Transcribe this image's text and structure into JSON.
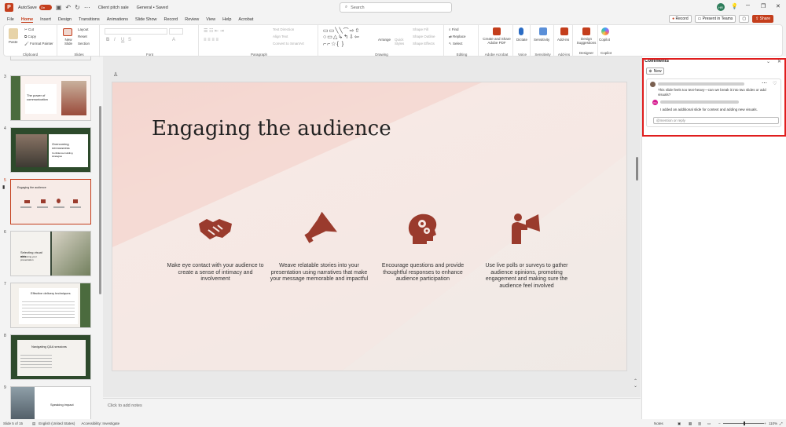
{
  "titlebar": {
    "app_logo": "P",
    "autosave_label": "AutoSave",
    "autosave_state": "On",
    "doc_name": "Client pitch sale",
    "sensitivity": "General • Saved",
    "search_placeholder": "Search",
    "user_initials": "HR"
  },
  "menu": {
    "tabs": [
      "File",
      "Home",
      "Insert",
      "Design",
      "Transitions",
      "Animations",
      "Slide Show",
      "Record",
      "Review",
      "View",
      "Help",
      "Acrobat"
    ],
    "active": "Home",
    "record_label": "Record",
    "present_label": "Present in Teams",
    "share_label": "Share"
  },
  "ribbon": {
    "clipboard": {
      "paste": "Paste",
      "cut": "Cut",
      "copy": "Copy",
      "format_painter": "Format Painter",
      "label": "Clipboard"
    },
    "slides": {
      "new_slide": "New Slide",
      "layout": "Layout",
      "reset": "Reset",
      "section": "Section",
      "label": "Slides"
    },
    "font": {
      "label": "Font"
    },
    "paragraph": {
      "text_direction": "Text Direction",
      "align_text": "Align Text",
      "convert_smartart": "Convert to SmartArt",
      "label": "Paragraph"
    },
    "drawing": {
      "arrange": "Arrange",
      "quick_styles": "Quick Styles",
      "shape_fill": "Shape Fill",
      "shape_outline": "Shape Outline",
      "shape_effects": "Shape Effects",
      "label": "Drawing"
    },
    "editing": {
      "find": "Find",
      "replace": "Replace",
      "select": "Select",
      "label": "Editing"
    },
    "acrobat": {
      "create_share": "Create and Share Adobe PDF",
      "label": "Adobe Acrobat"
    },
    "voice": {
      "dictate": "Dictate",
      "label": "Voice"
    },
    "sensitivity": {
      "btn": "Sensitivity",
      "label": "Sensitivity"
    },
    "addins": {
      "btn": "Add-ins",
      "label": "Add-ins"
    },
    "designer": {
      "btn": "Design Suggestions",
      "label": "Designer"
    },
    "copilot": {
      "btn": "Copilot",
      "label": "Copilot"
    }
  },
  "thumbnails": [
    {
      "num": "",
      "title": "",
      "bg": "#f2f2f2"
    },
    {
      "num": "3",
      "title": "The power of communication",
      "bg": "#fbf3f0"
    },
    {
      "num": "4",
      "title": "Overcoming nervousness",
      "sub": "Confidence-building strategies",
      "bg": "#2d4a2b"
    },
    {
      "num": "5",
      "title": "Engaging the audience",
      "bg": "#f7ebe7"
    },
    {
      "num": "6",
      "title": "Selecting visual aids",
      "sub": "Enhancing your presentation",
      "bg": "#3b4a3a"
    },
    {
      "num": "7",
      "title": "Effective delivery techniques",
      "bg": "#f4f1ec"
    },
    {
      "num": "8",
      "title": "Navigating Q&A sessions",
      "bg": "#2e4a2c"
    },
    {
      "num": "9",
      "title": "Speaking impact",
      "bg": "#ffffff"
    }
  ],
  "slide": {
    "title": "Engaging the audience",
    "features": [
      {
        "icon": "handshake-icon",
        "text": "Make eye contact with your audience to create a sense of intimacy and involvement"
      },
      {
        "icon": "megaphone-icon",
        "text": "Weave relatable stories into your presentation using narratives that make your message memorable and impactful"
      },
      {
        "icon": "head-gears-icon",
        "text": "Encourage questions and provide thoughtful responses to enhance audience participation"
      },
      {
        "icon": "person-megaphone-icon",
        "text": "Use live polls or surveys to gather audience opinions, promoting engagement and making sure the audience feel involved"
      }
    ],
    "accent_color": "#9a3b2d"
  },
  "notes": {
    "placeholder": "Click to add notes"
  },
  "comments": {
    "title": "Comments",
    "new_label": "New",
    "thread": [
      {
        "text": "This slide feels too text-heavy—can we break it into two slides or add visuals?"
      },
      {
        "initials": "KG",
        "text": "I added an additional slide for context and adding new visuals."
      }
    ],
    "reply_placeholder": "@mention or reply"
  },
  "status": {
    "slide_count": "Slide 5 of 15",
    "language": "English (United States)",
    "accessibility": "Accessibility: Investigate",
    "notes": "Notes",
    "zoom": "110%"
  }
}
